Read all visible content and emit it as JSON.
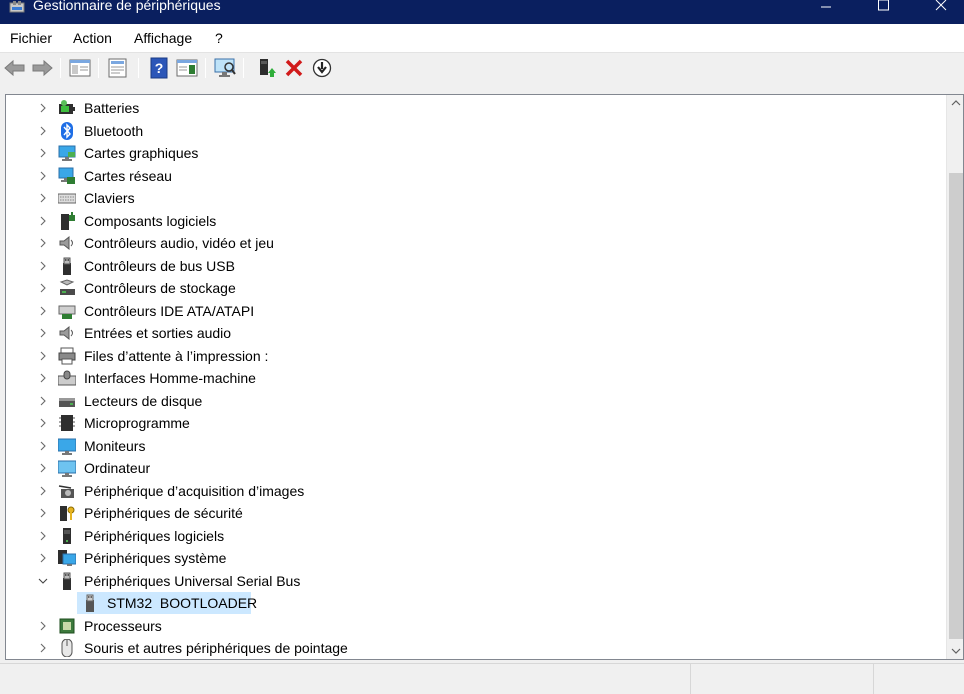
{
  "titlebar": {
    "title": "Gestionnaire de périphériques",
    "minimize_icon": "minimize-icon",
    "maximize_icon": "maximize-icon",
    "close_icon": "close-icon"
  },
  "menu": {
    "items": [
      "Fichier",
      "Action",
      "Affichage",
      "?"
    ]
  },
  "toolbar": {
    "buttons": [
      "back-arrow-icon",
      "forward-arrow-icon",
      "show-hide-console-tree-icon",
      "properties-icon",
      "help-icon",
      "show-action-pane-icon",
      "scan-hardware-changes-icon",
      "update-driver-icon",
      "uninstall-device-icon",
      "disable-device-icon"
    ]
  },
  "tree": {
    "categories": [
      {
        "label": "Batteries",
        "icon": "battery-icon",
        "expanded": false
      },
      {
        "label": "Bluetooth",
        "icon": "bluetooth-icon",
        "expanded": false
      },
      {
        "label": "Cartes graphiques",
        "icon": "display-adapter-icon",
        "expanded": false
      },
      {
        "label": "Cartes réseau",
        "icon": "network-adapter-icon",
        "expanded": false
      },
      {
        "label": "Claviers",
        "icon": "keyboard-icon",
        "expanded": false
      },
      {
        "label": "Composants logiciels",
        "icon": "software-component-icon",
        "expanded": false
      },
      {
        "label": "Contrôleurs audio, vidéo et jeu",
        "icon": "speaker-icon",
        "expanded": false
      },
      {
        "label": "Contrôleurs de bus USB",
        "icon": "usb-icon",
        "expanded": false
      },
      {
        "label": "Contrôleurs de stockage",
        "icon": "storage-controller-icon",
        "expanded": false
      },
      {
        "label": "Contrôleurs IDE ATA/ATAPI",
        "icon": "ide-controller-icon",
        "expanded": false
      },
      {
        "label": "Entrées et sorties audio",
        "icon": "speaker-icon",
        "expanded": false
      },
      {
        "label": "Files d’attente à l’impression :",
        "icon": "printer-icon",
        "expanded": false
      },
      {
        "label": "Interfaces Homme-machine",
        "icon": "hid-icon",
        "expanded": false
      },
      {
        "label": "Lecteurs de disque",
        "icon": "disk-drive-icon",
        "expanded": false
      },
      {
        "label": "Microprogramme",
        "icon": "firmware-icon",
        "expanded": false
      },
      {
        "label": "Moniteurs",
        "icon": "monitor-icon",
        "expanded": false
      },
      {
        "label": "Ordinateur",
        "icon": "computer-icon",
        "expanded": false
      },
      {
        "label": "Périphérique d’acquisition d’images",
        "icon": "camera-icon",
        "expanded": false
      },
      {
        "label": "Périphériques de sécurité",
        "icon": "security-device-icon",
        "expanded": false
      },
      {
        "label": "Périphériques logiciels",
        "icon": "software-device-icon",
        "expanded": false
      },
      {
        "label": "Périphériques système",
        "icon": "system-device-icon",
        "expanded": false
      },
      {
        "label": "Périphériques Universal Serial Bus",
        "icon": "usb-icon",
        "expanded": true,
        "children": [
          {
            "label": "STM32  BOOTLOADER",
            "icon": "usb-device-icon",
            "selected": true
          }
        ]
      },
      {
        "label": "Processeurs",
        "icon": "processor-icon",
        "expanded": false
      },
      {
        "label": "Souris et autres périphériques de pointage",
        "icon": "mouse-icon",
        "expanded": false
      }
    ]
  },
  "colors": {
    "titlebar_bg": "#0a1f5f",
    "selection_bg": "#cce8ff",
    "uninstall_red": "#d11a1a"
  }
}
